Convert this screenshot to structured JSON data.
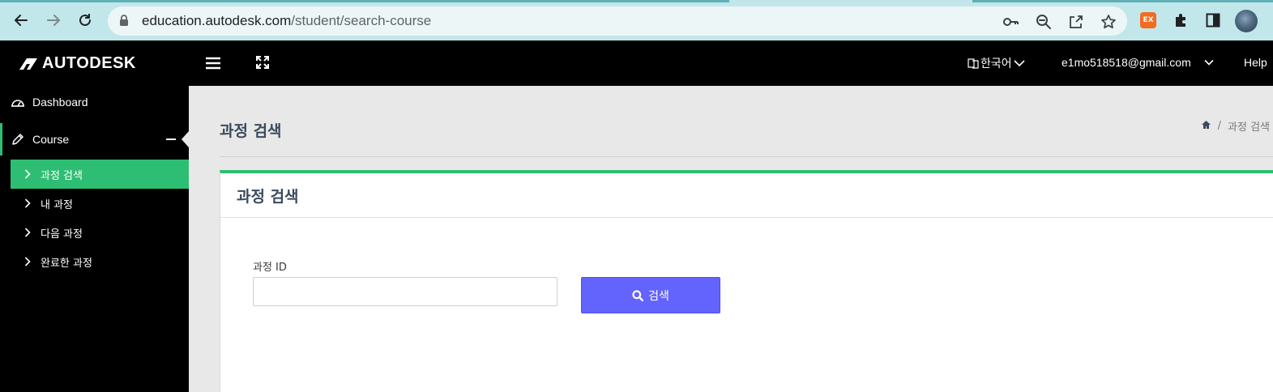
{
  "browser": {
    "url_host": "education.autodesk.com",
    "url_path": "/student/search-course",
    "extension_badge": "EX",
    "icons": [
      "back-icon",
      "forward-icon",
      "reload-icon",
      "lock-icon",
      "key-icon",
      "zoom-out-icon",
      "share-icon",
      "star-icon",
      "extension-ex-icon",
      "puzzle-icon",
      "side-panel-icon",
      "profile-avatar"
    ]
  },
  "header": {
    "logo_text": "AUTODESK",
    "language": "한국어",
    "user_email": "e1mo518518@gmail.com",
    "help": "Help"
  },
  "sidebar": {
    "dashboard": "Dashboard",
    "course": "Course",
    "sub_items": [
      {
        "label": "과정 검색",
        "active": true
      },
      {
        "label": "내 과정",
        "active": false
      },
      {
        "label": "다음 과정",
        "active": false
      },
      {
        "label": "완료한 과정",
        "active": false
      }
    ]
  },
  "main": {
    "page_title": "과정 검색",
    "breadcrumb_current": "과정 검색",
    "breadcrumb_separator": "/",
    "card_title": "과정 검색",
    "field_label": "과정 ID",
    "field_value": "",
    "search_button": "검색"
  },
  "colors": {
    "accent_green": "#2dbe73",
    "button_blue": "#6364fd",
    "chrome_bg": "#c2e7ea",
    "header_bg": "#000000",
    "content_bg": "#e8e8e8",
    "title_text": "#3b4a5e"
  }
}
